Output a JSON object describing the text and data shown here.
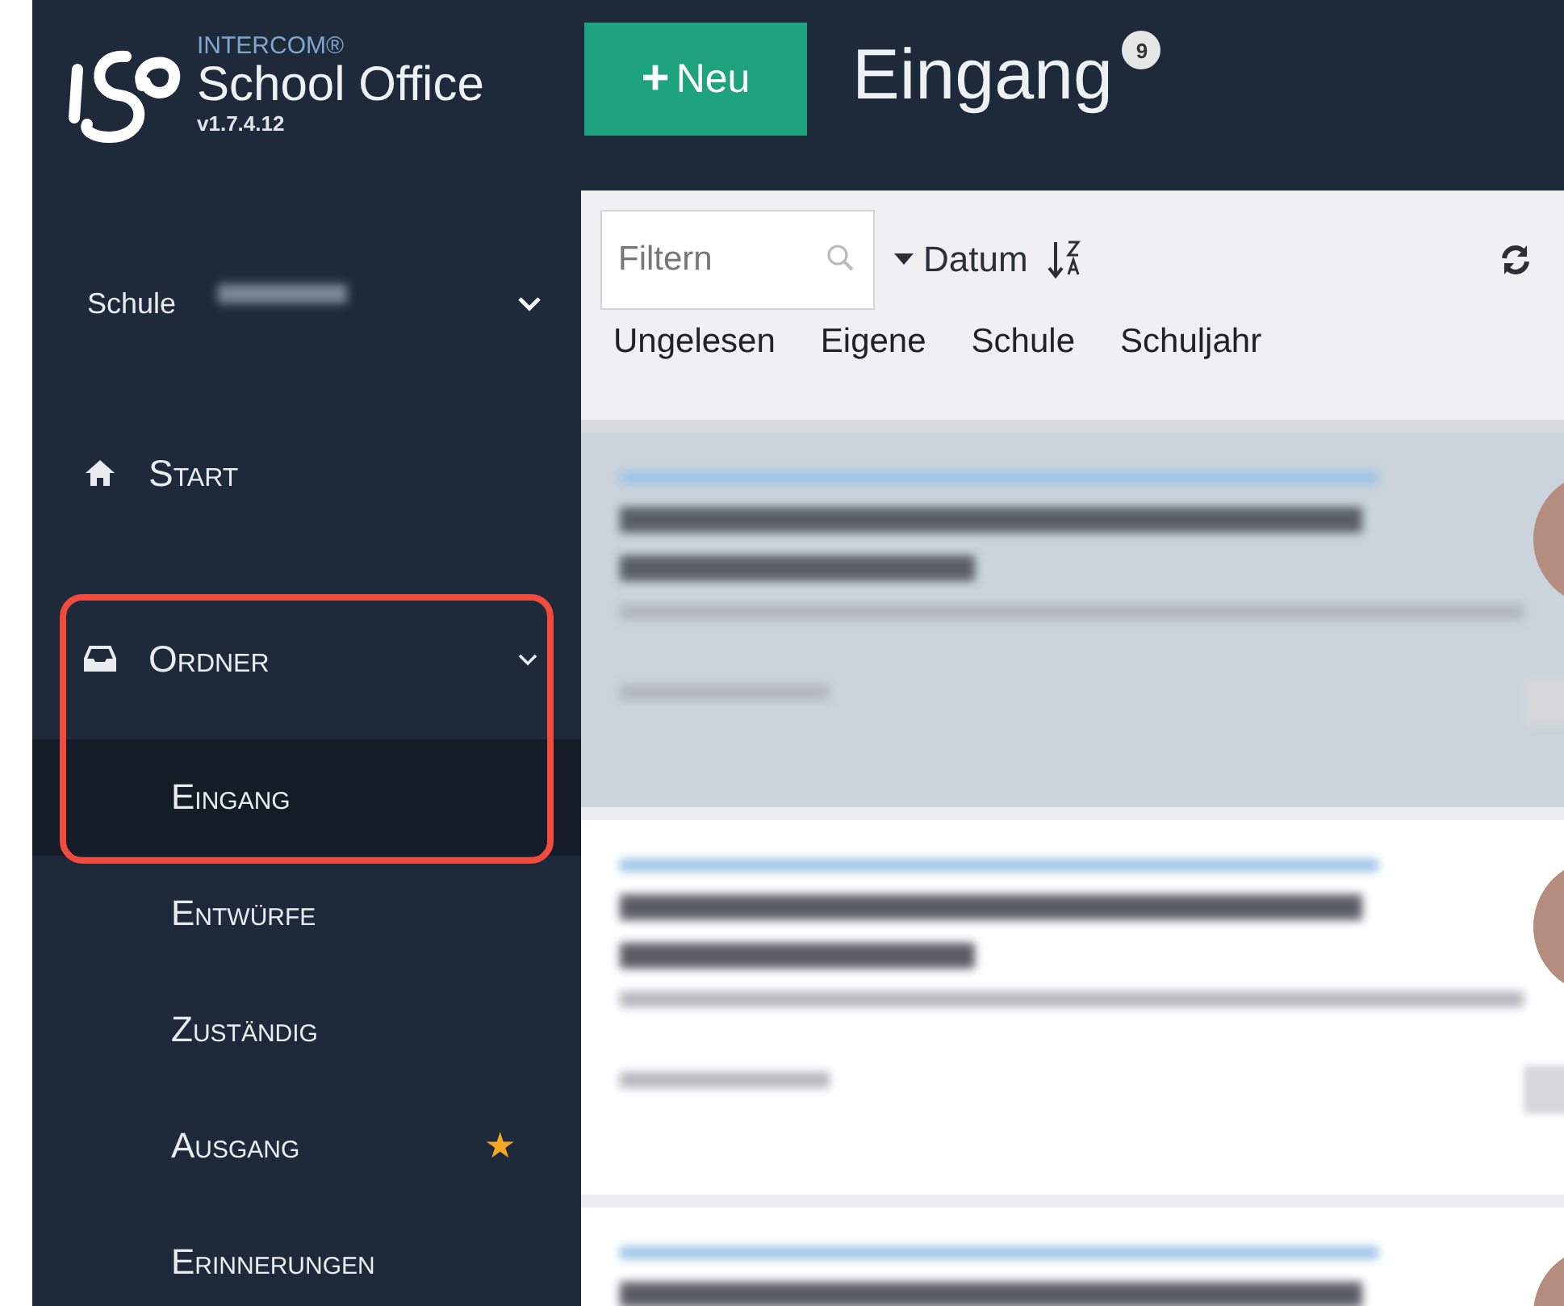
{
  "app": {
    "brand": "INTERCOM®",
    "name": "School Office",
    "version": "v1.7.4.12"
  },
  "school": {
    "label": "Schule"
  },
  "nav": [
    {
      "label": "Start",
      "kind": "home",
      "highlighted": false
    },
    {
      "label": "Ordner",
      "kind": "folder",
      "expanded": true,
      "highlighted": true,
      "children": [
        {
          "label": "Eingang",
          "selected": true
        },
        {
          "label": "Entwürfe",
          "selected": false
        },
        {
          "label": "Zuständig",
          "selected": false
        },
        {
          "label": "Ausgang",
          "selected": false,
          "star": "★"
        },
        {
          "label": "Erinnerungen",
          "selected": false
        }
      ]
    }
  ],
  "new_button": {
    "icon": "+",
    "label": "Neu"
  },
  "header": {
    "title": "Eingang",
    "count": "9"
  },
  "filter": {
    "placeholder": "Filtern"
  },
  "sort": {
    "label": "Datum"
  },
  "quick_filters": [
    "Ungelesen",
    "Eigene",
    "Schule",
    "Schuljahr"
  ],
  "messages": [
    {
      "selected": true
    },
    {
      "selected": false
    },
    {
      "selected": false
    }
  ]
}
